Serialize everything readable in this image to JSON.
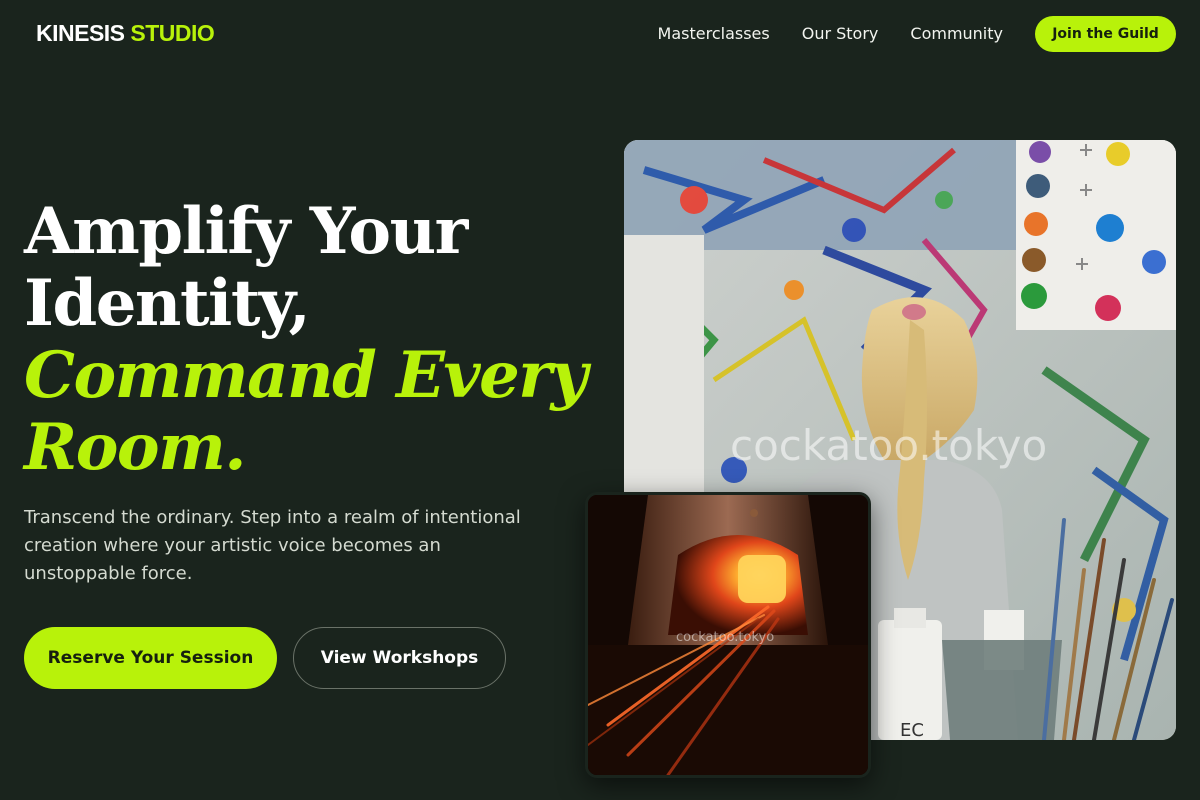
{
  "header": {
    "logo_primary": "KINESIS",
    "logo_accent": "STUDIO",
    "nav": [
      {
        "label": "Masterclasses"
      },
      {
        "label": "Our Story"
      },
      {
        "label": "Community"
      }
    ],
    "cta_label": "Join the Guild"
  },
  "hero": {
    "title_line1": "Amplify Your",
    "title_line2": "Identity,",
    "title_line3": "Command Every",
    "title_line4": "Room.",
    "subtitle": "Transcend the ordinary. Step into a realm of intentional creation where your artistic voice becomes an unstoppable force.",
    "primary_button": "Reserve Your Session",
    "secondary_button": "View Workshops"
  },
  "images": {
    "main_watermark": "cockatoo.tokyo",
    "inset_watermark": "cockatoo.tokyo",
    "jar_label": "EC"
  },
  "colors": {
    "background": "#1a241d",
    "accent": "#b8f20a",
    "text": "#ffffff"
  }
}
